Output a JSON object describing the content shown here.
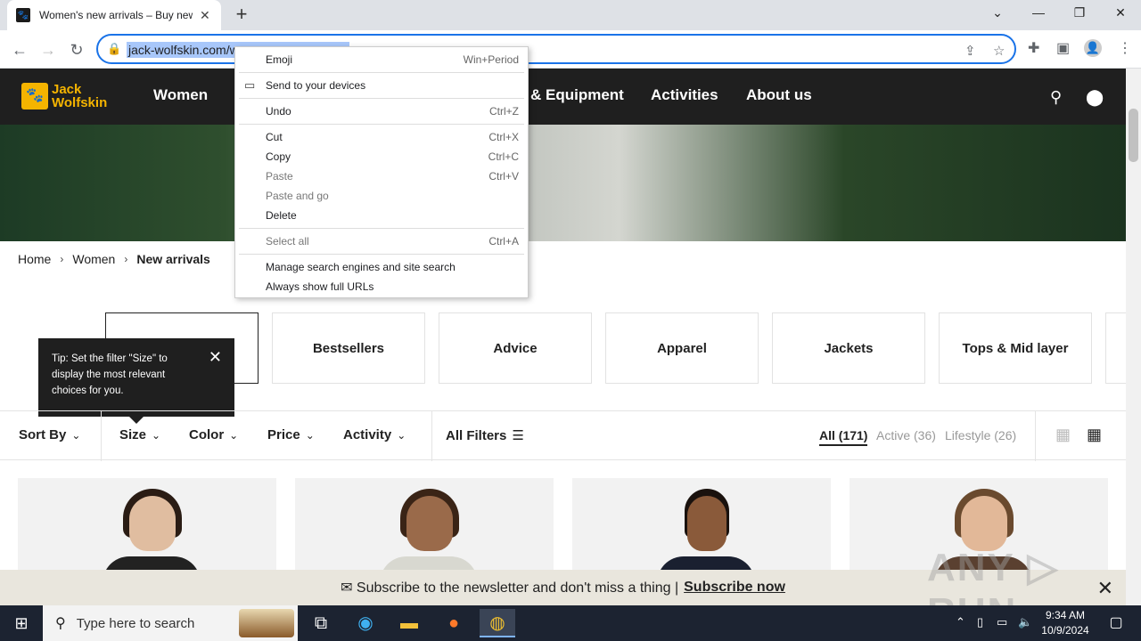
{
  "browser": {
    "tab_title": "Women's new arrivals – Buy new",
    "tab_close": "✕",
    "new_tab": "+",
    "url": "jack-wolfskin.com/w"
  },
  "site": {
    "logo_line1": "Jack",
    "logo_line2": "Wolfskin",
    "nav": [
      "Women",
      "& Equipment",
      "Activities",
      "About us"
    ],
    "breadcrumb": [
      "Home",
      "Women",
      "New arrivals"
    ],
    "categories": [
      "",
      "Bestsellers",
      "Advice",
      "Apparel",
      "Jackets",
      "Tops & Mid layer"
    ],
    "tooltip": "Tip: Set the filter \"Size\" to display the most relevant choices for you.",
    "filters": [
      "Sort By",
      "Size",
      "Color",
      "Price",
      "Activity"
    ],
    "all_filters": "All Filters",
    "segments": [
      "All (171)",
      "Active (36)",
      "Lifestyle (26)"
    ],
    "newsletter_text": "✉ Subscribe to the newsletter and don't miss a thing |",
    "newsletter_link": "Subscribe now",
    "watermark": "ANY ▷ RUN"
  },
  "context_menu": [
    {
      "label": "Emoji",
      "shortcut": "Win+Period",
      "disabled": false
    },
    {
      "label": "Send to your devices",
      "shortcut": "",
      "disabled": false
    },
    {
      "label": "Undo",
      "shortcut": "Ctrl+Z",
      "disabled": false
    },
    {
      "label": "Cut",
      "shortcut": "Ctrl+X",
      "disabled": false
    },
    {
      "label": "Copy",
      "shortcut": "Ctrl+C",
      "disabled": false
    },
    {
      "label": "Paste",
      "shortcut": "Ctrl+V",
      "disabled": true
    },
    {
      "label": "Paste and go",
      "shortcut": "",
      "disabled": true
    },
    {
      "label": "Delete",
      "shortcut": "",
      "disabled": false
    },
    {
      "label": "Select all",
      "shortcut": "Ctrl+A",
      "disabled": true
    },
    {
      "label": "Manage search engines and site search",
      "shortcut": "",
      "disabled": false
    },
    {
      "label": "Always show full URLs",
      "shortcut": "",
      "disabled": false
    }
  ],
  "taskbar": {
    "search_placeholder": "Type here to search",
    "time": "9:34 AM",
    "date": "10/9/2024"
  }
}
